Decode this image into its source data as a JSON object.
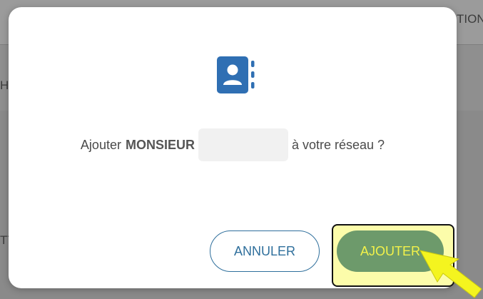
{
  "background": {
    "header_text_right": "TION",
    "left_text_1": "HI",
    "left_text_2": "TT"
  },
  "dialog": {
    "icon": "contact-book-icon",
    "message_prefix": "Ajouter",
    "message_name": "MONSIEUR",
    "message_suffix": "à votre réseau ?",
    "cancel_label": "ANNULER",
    "add_label": "AJOUTER"
  },
  "colors": {
    "primary": "#2f6f9c",
    "add_button_bg": "#6d9a6b",
    "add_button_text": "#f2f24a",
    "highlight": "#fcfcaa",
    "pointer": "#f4f41f"
  }
}
